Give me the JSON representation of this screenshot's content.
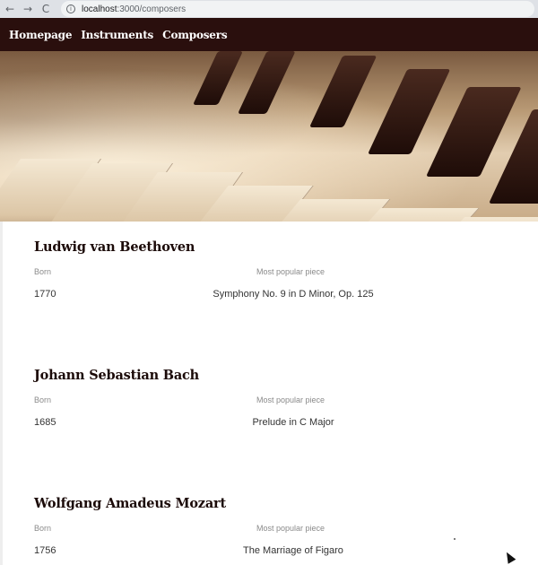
{
  "browser": {
    "back_icon": "←",
    "forward_icon": "→",
    "reload_icon": "C",
    "info_icon": "i",
    "url_host": "localhost",
    "url_path": ":3000/composers"
  },
  "nav": {
    "items": [
      {
        "label": "Homepage"
      },
      {
        "label": "Instruments"
      },
      {
        "label": "Composers"
      }
    ]
  },
  "columns": {
    "born": "Born",
    "piece": "Most popular piece"
  },
  "composers": [
    {
      "name": "Ludwig van Beethoven",
      "born": "1770",
      "piece": "Symphony No. 9 in D Minor, Op. 125"
    },
    {
      "name": "Johann Sebastian Bach",
      "born": "1685",
      "piece": "Prelude in C Major"
    },
    {
      "name": "Wolfgang Amadeus Mozart",
      "born": "1756",
      "piece": "The Marriage of Figaro"
    }
  ],
  "colors": {
    "header_bg": "#2a0f0d",
    "heading_text": "#1b0a08"
  }
}
